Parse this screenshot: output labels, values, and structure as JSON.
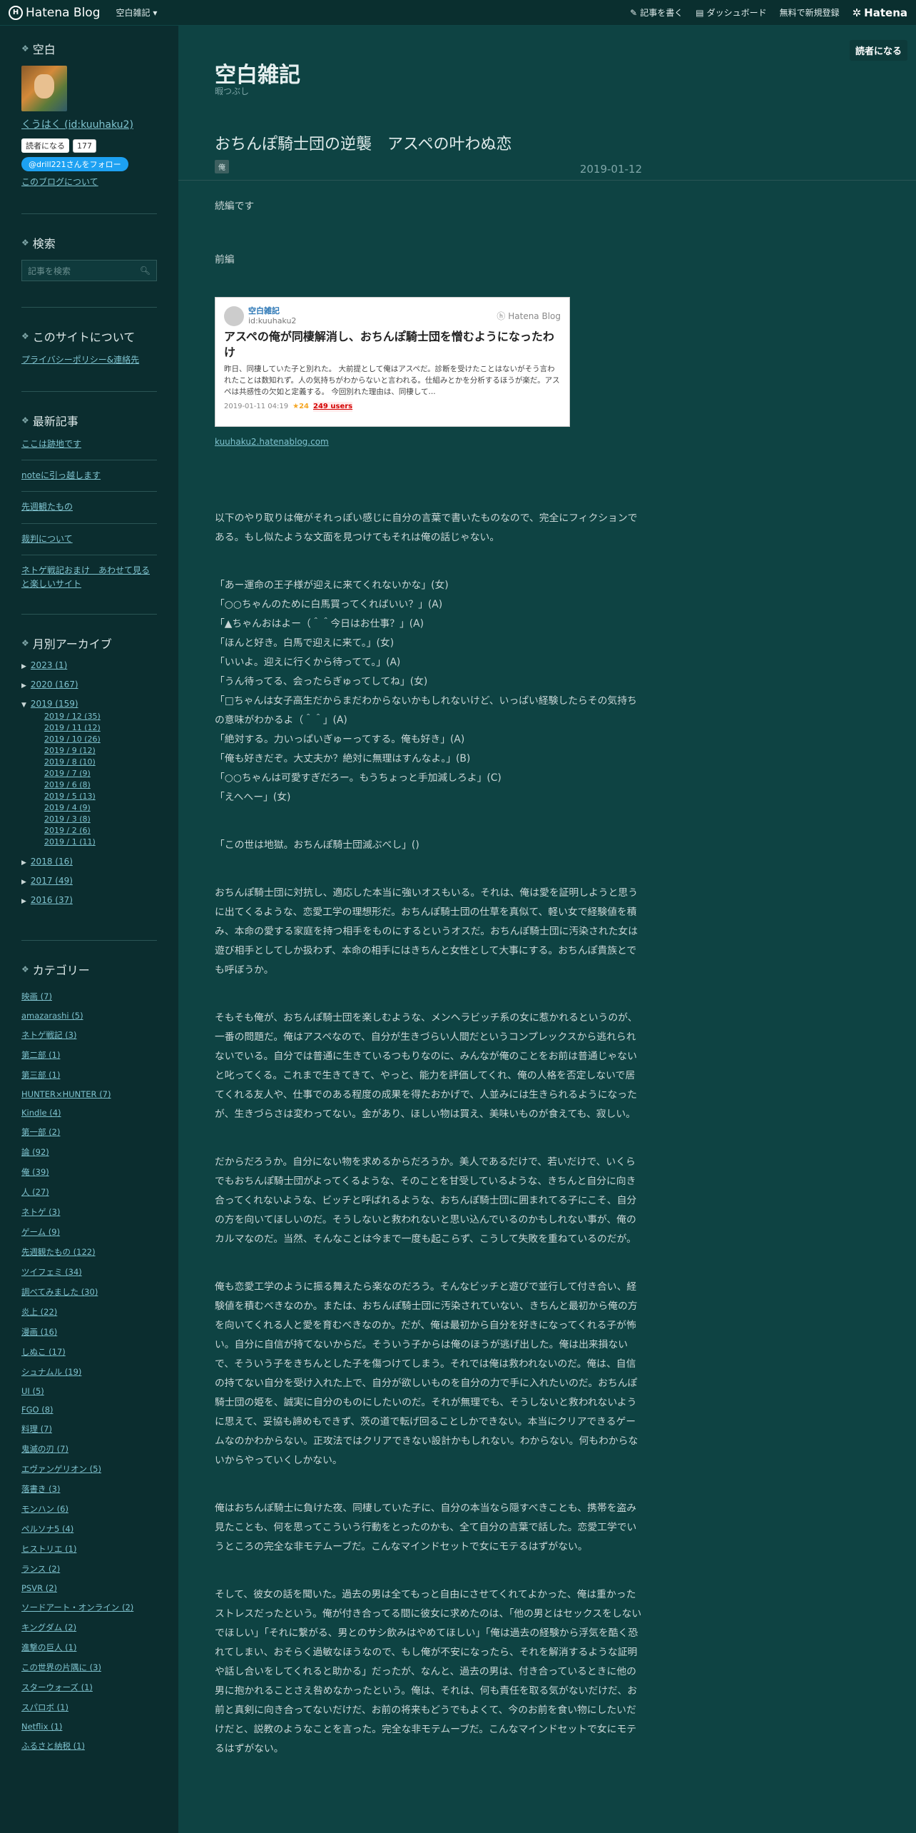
{
  "topbar": {
    "logo": "Hatena Blog",
    "blog_selector": "空白雑記 ▾",
    "write": "記事を書く",
    "dashboard": "ダッシュボード",
    "signup": "無料で新規登録",
    "hatena": "Hatena"
  },
  "sidebar": {
    "profile": {
      "heading": "空白",
      "user": "くうはく (id:kuuhaku2)",
      "reader_btn": "読者になる",
      "reader_count": "177",
      "follow": "@drill221さんをフォロー",
      "about": "このブログについて"
    },
    "search": {
      "heading": "検索",
      "placeholder": "記事を検索"
    },
    "site": {
      "heading": "このサイトについて",
      "link": "プライバシーポリシー&連絡先"
    },
    "recent": {
      "heading": "最新記事",
      "items": [
        "ここは跡地です",
        "noteに引っ越します",
        "先週観たもの",
        "裁判について",
        "ネトゲ戦記おまけ　あわせて見ると楽しいサイト"
      ]
    },
    "archive": {
      "heading": "月別アーカイブ",
      "years": [
        "2023 (1)",
        "2020 (167)",
        "2019 (159)",
        "2018 (16)",
        "2017 (49)",
        "2016 (37)"
      ],
      "months": [
        "2019 / 12 (35)",
        "2019 / 11 (12)",
        "2019 / 10 (26)",
        "2019 / 9 (12)",
        "2019 / 8 (10)",
        "2019 / 7 (9)",
        "2019 / 6 (8)",
        "2019 / 5 (13)",
        "2019 / 4 (9)",
        "2019 / 3 (8)",
        "2019 / 2 (6)",
        "2019 / 1 (11)"
      ]
    },
    "categories": {
      "heading": "カテゴリー",
      "items": [
        "映画 (7)",
        "amazarashi (5)",
        "ネトゲ戦記 (3)",
        "第二部 (1)",
        "第三部 (1)",
        "HUNTER×HUNTER (7)",
        "Kindle (4)",
        "第一部 (2)",
        "論 (92)",
        "俺 (39)",
        "人 (27)",
        "ネトゲ (3)",
        "ゲーム (9)",
        "先週観たもの (122)",
        "ツイフェミ (34)",
        "調べてみました (30)",
        "炎上 (22)",
        "漫画 (16)",
        "しぬこ (17)",
        "シュナムル (19)",
        "UI (5)",
        "FGO (8)",
        "料理 (7)",
        "鬼滅の刃 (7)",
        "エヴァンゲリオン (5)",
        "落書き (3)",
        "モンハン (6)",
        "ペルソナ5 (4)",
        "ヒストリエ (1)",
        "ランス (2)",
        "PSVR (2)",
        "ソードアート・オンライン (2)",
        "キングダム (2)",
        "進撃の巨人 (1)",
        "この世界の片隅に (3)",
        "スターウォーズ (1)",
        "スパロボ (1)",
        "Netflix (1)",
        "ふるさと納税 (1)"
      ]
    }
  },
  "main": {
    "reader_btn": "読者になる",
    "blog_title": "空白雑記",
    "blog_desc": "暇つぶし",
    "entry_title": "おちんぽ騎士団の逆襲　アスペの叶わぬ恋",
    "category_tag": "俺",
    "date": "2019-01-12",
    "p1": "続編です",
    "p2": "前編",
    "card": {
      "blog": "空白雑記",
      "uid": "id:kuuhaku2",
      "hatena": "Hatena Blog",
      "title": "アスペの俺が同棲解消し、おちんぽ騎士団を憎むようになったわけ",
      "excerpt": "昨日、同棲していた子と別れた。 大前提として俺はアスペだ。診断を受けたことはないがそう言われたことは数知れず。人の気持ちがわからないと言われる。仕組みとかを分析するほうが楽だ。アスペは共感性の欠如と定義する。 今回別れた理由は、同棲して...",
      "date": "2019-01-11 04:19",
      "stars": "★24",
      "users": "249 users"
    },
    "source": "kuuhaku2.hatenablog.com",
    "p3": "以下のやり取りは俺がそれっぽい感じに自分の言葉で書いたものなので、完全にフィクションである。もし似たような文面を見つけてもそれは俺の話じゃない。",
    "dialog": [
      "「あー運命の王子様が迎えに来てくれないかな」(女)",
      "「○○ちゃんのために白馬買ってくればいい？」(A)",
      "「▲ちゃんおはよー（＾＾今日はお仕事？」(A)",
      "「ほんと好き。白馬で迎えに来て。」(女)",
      "「いいよ。迎えに行くから待ってて。」(A)",
      "「うん待ってる、会ったらぎゅってしてね」(女)",
      "「□ちゃんは女子高生だからまだわからないかもしれないけど、いっぱい経験したらその気持ちの意味がわかるよ（＾＾」(A)",
      "「絶対する。力いっぱいぎゅーってする。俺も好き」(A)",
      "「俺も好きだぞ。大丈夫か？絶対に無理はすんなよ。」(B)",
      "「○○ちゃんは可愛すぎだろー。もうちょっと手加減しろよ」(C)",
      "「えへへー」(女)"
    ],
    "p4": "「この世は地獄。おちんぽ騎士団滅ぶべし」()",
    "p5": "おちんぽ騎士団に対抗し、適応した本当に強いオスもいる。それは、俺は愛を証明しようと思うに出てくるような、恋愛工学の理想形だ。おちんぽ騎士団の仕草を真似て、軽い女で経験値を積み、本命の愛する家庭を持つ相手をものにするというオスだ。おちんぽ騎士団に汚染された女は遊び相手としてしか扱わず、本命の相手にはきちんと女性として大事にする。おちんぽ貴族とでも呼ぼうか。",
    "p6": "そもそも俺が、おちんぽ騎士団を楽しむような、メンヘラビッチ系の女に惹かれるというのが、一番の問題だ。俺はアスペなので、自分が生きづらい人間だというコンプレックスから逃れられないでいる。自分では普通に生きているつもりなのに、みんなが俺のことをお前は普通じゃないと叱ってくる。これまで生きてきて、やっと、能力を評価してくれ、俺の人格を否定しないで居てくれる友人や、仕事でのある程度の成果を得たおかげで、人並みには生きられるようになったが、生きづらさは変わってない。金があり、ほしい物は買え、美味いものが食えても、寂しい。",
    "p7": "だからだろうか。自分にない物を求めるからだろうか。美人であるだけで、若いだけで、いくらでもおちんぽ騎士団がよってくるような、そのことを甘受しているような、きちんと自分に向き合ってくれないような、ビッチと呼ばれるような、おちんぽ騎士団に囲まれてる子にこそ、自分の方を向いてほしいのだ。そうしないと救われないと思い込んでいるのかもしれない事が、俺のカルマなのだ。当然、そんなことは今まで一度も起こらず、こうして失敗を重ねているのだが。",
    "p8": "俺も恋愛工学のように振る舞えたら楽なのだろう。そんなビッチと遊びで並行して付き合い、経験値を積むべきなのか。または、おちんぽ騎士団に汚染されていない、きちんと最初から俺の方を向いてくれる人と愛を育むべきなのか。だが、俺は最初から自分を好きになってくれる子が怖い。自分に自信が持てないからだ。そういう子からは俺のほうが逃げ出した。俺は出来損ないで、そういう子をきちんとした子を傷つけてしまう。それでは俺は救われないのだ。俺は、自信の持てない自分を受け入れた上で、自分が欲しいものを自分の力で手に入れたいのだ。おちんぽ騎士団の姫を、誠実に自分のものにしたいのだ。それが無理でも、そうしないと救われないように思えて、妥協も諦めもできず、茨の道で転げ回ることしかできない。本当にクリアできるゲームなのかわからない。正攻法ではクリアできない設計かもしれない。わからない。何もわからないからやっていくしかない。",
    "p9": "俺はおちんぽ騎士に負けた夜、同棲していた子に、自分の本当なら隠すべきことも、携帯を盗み見たことも、何を思ってこういう行動をとったのかも、全て自分の言葉で話した。恋愛工学でいうところの完全な非モテムーブだ。こんなマインドセットで女にモテるはずがない。",
    "p10": "そして、彼女の話を聞いた。過去の男は全てもっと自由にさせてくれてよかった、俺は重かったストレスだったという。俺が付き合ってる間に彼女に求めたのは、「他の男とはセックスをしないでほしい」「それに繋がる、男とのサシ飲みはやめてほしい」「俺は過去の経験から浮気を酷く恐れてしまい、おそらく過敏なほうなので、もし俺が不安になったら、それを解消するような証明や話し合いをしてくれると助かる」だったが、なんと、過去の男は、付き合っているときに他の男に抱かれることさえ咎めなかったという。俺は、それは、何も責任を取る気がないだけだ、お前と真剣に向き合ってないだけだ、お前の将来もどうでもよくて、今のお前を食い物にしたいだけだと、説教のようなことを言った。完全な非モテムーブだ。こんなマインドセットで女にモテるはずがない。"
  },
  "colors": {
    "bg": "#0d3a3a",
    "sidebar": "#0b2d2f",
    "main": "#0e4343",
    "link": "#7fc3cf"
  }
}
